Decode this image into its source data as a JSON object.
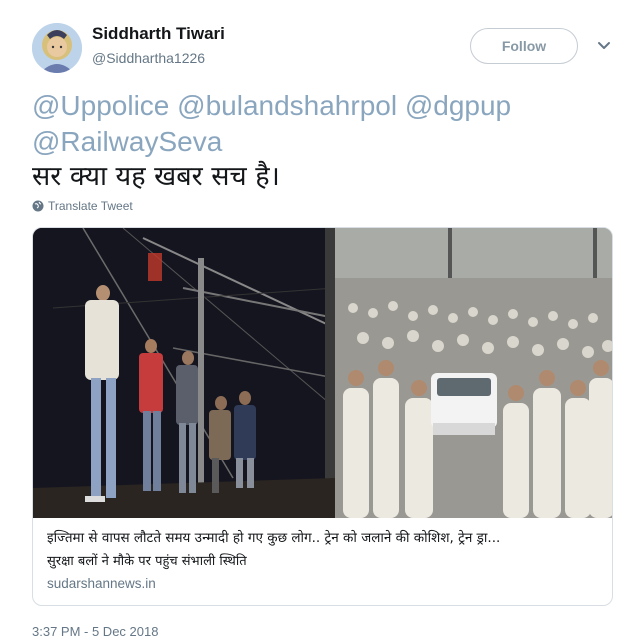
{
  "author": {
    "name": "Siddharth Tiwari",
    "handle": "@Siddhartha1226"
  },
  "follow_label": "Follow",
  "tweet": {
    "mentions": "@Uppolice @bulandshahrpol @dgpup @RailwaySeva",
    "text": "सर क्या यह खबर सच है।",
    "translate_label": "Translate Tweet"
  },
  "card": {
    "title": "इज्तिमा से वापस लौटते समय उन्मादी हो गए कुछ लोग.. ट्रेन को जलाने की कोशिश, ट्रेन ड्रा...",
    "description": "सुरक्षा बलों ने मौके पर पहुंच संभाली स्थिति",
    "domain": "sudarshannews.in"
  },
  "timestamp": "3:37 PM - 5 Dec 2018",
  "colors": {
    "mention": "#8aa6bf",
    "secondary_text": "#657786",
    "border": "#d8dee3"
  }
}
